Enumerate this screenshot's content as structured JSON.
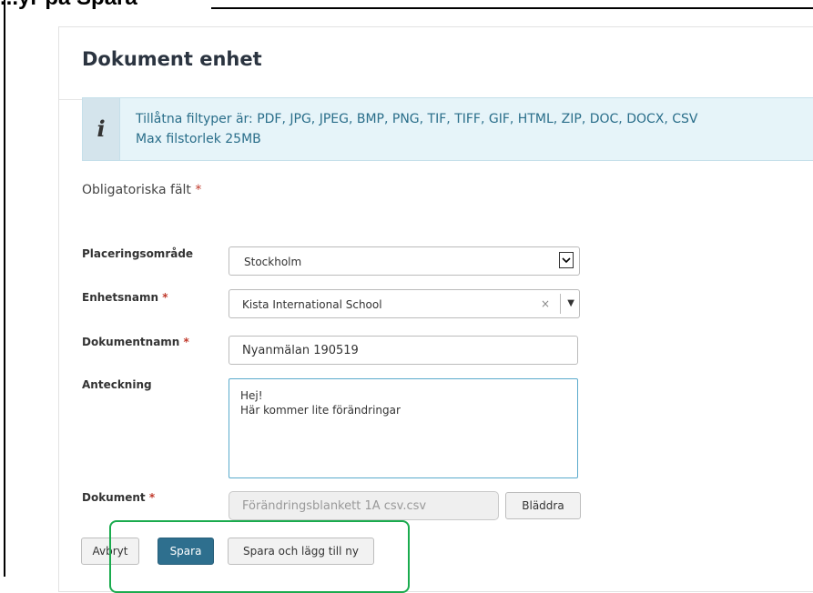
{
  "heading_cut": "...yr på Spara",
  "panel": {
    "title": "Dokument enhet"
  },
  "info": {
    "icon": "info-icon",
    "line1": "Tillåtna filtyper är: PDF, JPG, JPEG, BMP, PNG, TIF, TIFF, GIF, HTML, ZIP, DOC, DOCX, CSV",
    "line2": "Max filstorlek 25MB"
  },
  "required_note": {
    "text": "Obligatoriska fält",
    "star": "*"
  },
  "fields": {
    "placering": {
      "label": "Placeringsområde",
      "value": "Stockholm"
    },
    "enhet": {
      "label": "Enhetsnamn",
      "star": "*",
      "value": "Kista International School",
      "clear": "×"
    },
    "dokumentnamn": {
      "label": "Dokumentnamn",
      "star": "*",
      "value": "Nyanmälan 190519"
    },
    "anteckning": {
      "label": "Anteckning",
      "value": "Hej!\nHär kommer lite förändringar"
    },
    "dokument": {
      "label": "Dokument",
      "star": "*",
      "value": "Förändringsblankett 1A csv.csv",
      "browse_label": "Bläddra"
    }
  },
  "actions": {
    "cancel_label": "Avbryt",
    "save_label": "Spara",
    "save_new_label": "Spara och lägg till ny"
  },
  "colors": {
    "primary": "#2e6f8e",
    "info_bg": "#e6f4f9",
    "info_text": "#2a6e8a",
    "required": "#c0392b",
    "highlight": "#1aab4e"
  }
}
